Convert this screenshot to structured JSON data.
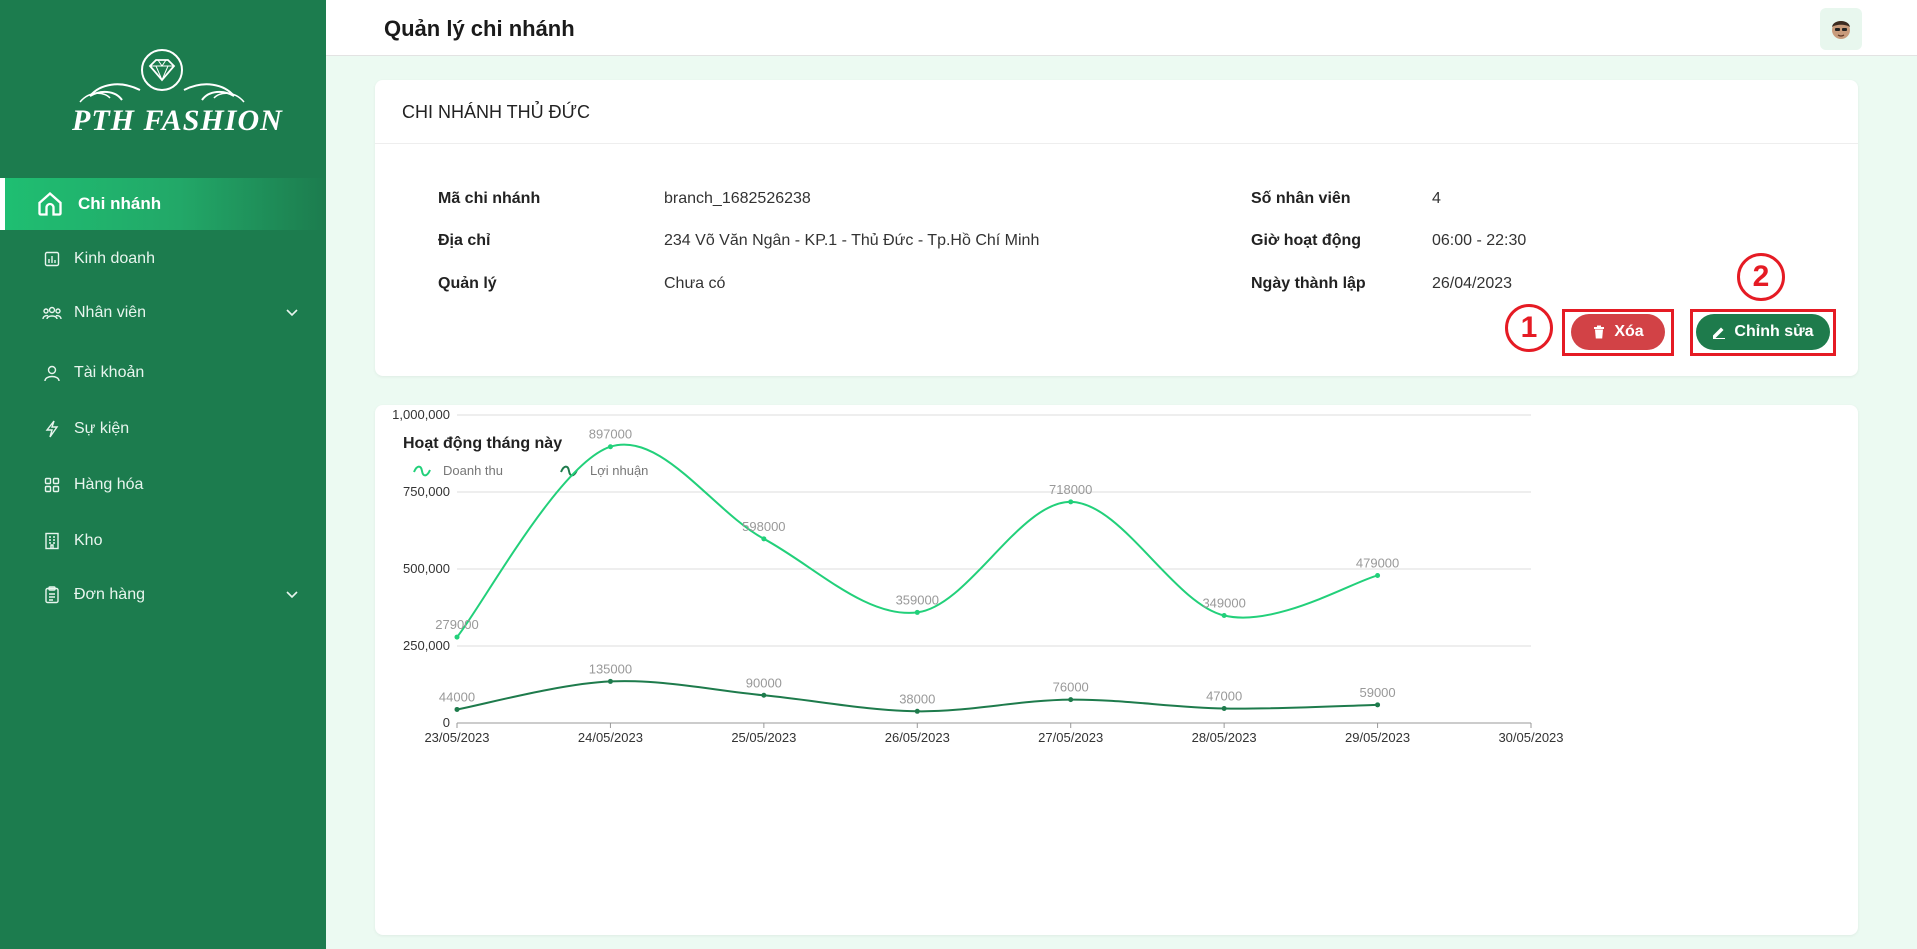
{
  "app": {
    "brand": "PTH FASHION"
  },
  "header": {
    "title": "Quản lý chi nhánh"
  },
  "sidebar": {
    "items": [
      {
        "label": "Chi nhánh",
        "icon": "home-icon",
        "active": true
      },
      {
        "label": "Kinh doanh",
        "icon": "bar-chart-icon"
      },
      {
        "label": "Nhân viên",
        "icon": "users-icon",
        "expandable": true
      },
      {
        "label": "Tài khoản",
        "icon": "account-icon"
      },
      {
        "label": "Sự kiện",
        "icon": "lightning-icon"
      },
      {
        "label": "Hàng hóa",
        "icon": "grid-icon"
      },
      {
        "label": "Kho",
        "icon": "building-icon"
      },
      {
        "label": "Đơn hàng",
        "icon": "clipboard-icon",
        "expandable": true
      }
    ]
  },
  "branch": {
    "title": "CHI NHÁNH THỦ ĐỨC",
    "code_label": "Mã chi nhánh",
    "code": "branch_1682526238",
    "address_label": "Địa chỉ",
    "address": "234 Võ Văn Ngân - KP.1 - Thủ Đức - Tp.Hồ Chí Minh",
    "manager_label": "Quản lý",
    "manager": "Chưa có",
    "staff_label": "Số nhân viên",
    "staff": "4",
    "hours_label": "Giờ hoạt động",
    "hours": "06:00 - 22:30",
    "founded_label": "Ngày thành lập",
    "founded": "26/04/2023"
  },
  "actions": {
    "delete_label": "Xóa",
    "edit_label": "Chỉnh sửa",
    "marker_delete": "1",
    "marker_edit": "2"
  },
  "colors": {
    "primary": "#1e7b4c",
    "sidebar": "#1c7c4e",
    "danger": "#d24246",
    "revenue": "#22d07a",
    "profit": "#1e7b4c",
    "highlight": "#e51b24"
  },
  "chart_data": {
    "type": "line",
    "title": "Hoạt động tháng này",
    "x": [
      "23/05/2023",
      "24/05/2023",
      "25/05/2023",
      "26/05/2023",
      "27/05/2023",
      "28/05/2023",
      "29/05/2023",
      "30/05/2023"
    ],
    "series": [
      {
        "name": "Doanh thu",
        "values": [
          279000,
          897000,
          598000,
          359000,
          718000,
          349000,
          479000
        ]
      },
      {
        "name": "Lợi nhuận",
        "values": [
          44000,
          135000,
          90000,
          38000,
          76000,
          47000,
          59000
        ]
      }
    ],
    "ylim": [
      0,
      1000000
    ],
    "yticks": [
      "0",
      "250,000",
      "500,000",
      "750,000",
      "1,000,000"
    ],
    "grid": true,
    "legend": "top-left"
  }
}
